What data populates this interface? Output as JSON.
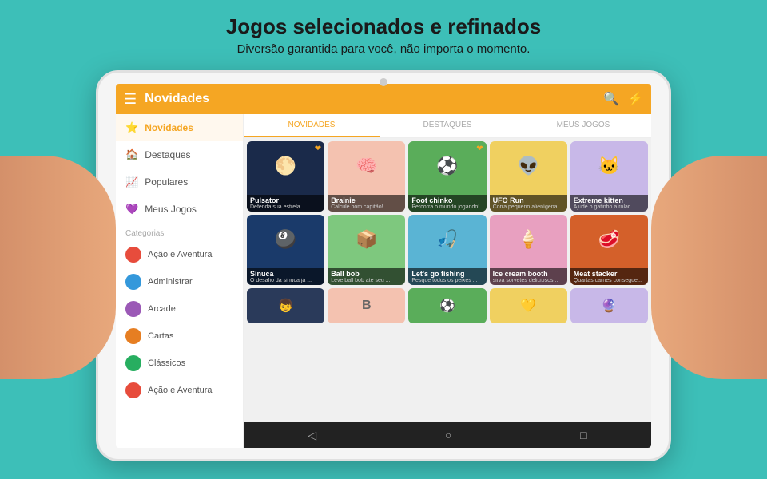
{
  "page": {
    "background_color": "#3dbfb8",
    "title": "Jogos selecionados e refinados",
    "subtitle": "Diversão garantida para você,  não importa o momento."
  },
  "header": {
    "title": "Novidades",
    "search_icon": "🔍",
    "flash_icon": "⚡"
  },
  "tabs": [
    {
      "label": "DESTAQUES",
      "active": false
    },
    {
      "label": "MEUS JOGOS",
      "active": false
    }
  ],
  "sidebar": {
    "nav_items": [
      {
        "label": "Novidades",
        "icon": "⭐",
        "active": true
      },
      {
        "label": "Destaques",
        "icon": "🏠",
        "active": false
      },
      {
        "label": "Populares",
        "icon": "📈",
        "active": false
      },
      {
        "label": "Meus Jogos",
        "icon": "💜",
        "active": false
      }
    ],
    "category_header": "Categorias",
    "categories": [
      {
        "label": "Ação e Aventura",
        "color": "#e74c3c"
      },
      {
        "label": "Administrar",
        "color": "#3498db"
      },
      {
        "label": "Arcade",
        "color": "#9b59b6"
      },
      {
        "label": "Cartas",
        "color": "#e67e22"
      },
      {
        "label": "Clássicos",
        "color": "#27ae60"
      },
      {
        "label": "Ação e Aventura",
        "color": "#e74c3c"
      }
    ]
  },
  "games_row1": [
    {
      "name": "Pulsator",
      "desc": "Defenda sua estrela ...",
      "bg": "#1a2a4a",
      "emoji": "🌕"
    },
    {
      "name": "Brainie",
      "desc": "Calcule bom capitão!",
      "bg": "#f4c2b0",
      "emoji": "🧠"
    },
    {
      "name": "Foot chinko",
      "desc": "Percorra o mundo jogando!",
      "bg": "#5aad5a",
      "emoji": "⚽"
    },
    {
      "name": "UFO Run",
      "desc": "Corra pequeno alienígena!",
      "bg": "#f0d060",
      "emoji": "👽"
    },
    {
      "name": "Extreme kitten",
      "desc": "Ajude o gatinho a rolar",
      "bg": "#c8b8e8",
      "emoji": "🐱"
    }
  ],
  "games_row2": [
    {
      "name": "Sinuca",
      "desc": "O desafio da sinuca já ...",
      "bg": "#1a3a6a",
      "emoji": "🎱"
    },
    {
      "name": "Ball bob",
      "desc": "Leve ball bob até seu ...",
      "bg": "#7ec87e",
      "emoji": "📦"
    },
    {
      "name": "Let's go fishing",
      "desc": "Pesque todos os peixes ...",
      "bg": "#5ab4d4",
      "emoji": "🎣"
    },
    {
      "name": "Ice cream booth",
      "desc": "sirva sorvetes deliciosos...",
      "bg": "#e8a0c0",
      "emoji": "🍦"
    },
    {
      "name": "Meat stacker",
      "desc": "Quartas carnes consegue...",
      "bg": "#d4602a",
      "emoji": "🥩"
    }
  ],
  "games_row3": [
    {
      "bg": "#2a3a5a",
      "emoji": "👦"
    },
    {
      "bg": "#f4c2b0",
      "emoji": "🅱"
    },
    {
      "bg": "#5aad5a",
      "emoji": "⚽"
    },
    {
      "bg": "#f0d060",
      "emoji": "💛"
    },
    {
      "bg": "#c8b8e8",
      "emoji": "🔮"
    }
  ],
  "android_nav": {
    "back": "◁",
    "home": "○",
    "recent": "□"
  }
}
